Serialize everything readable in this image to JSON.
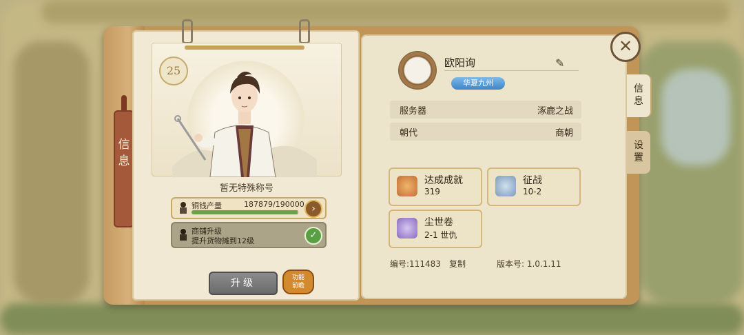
{
  "character": {
    "level": "25",
    "title": "暂无特殊称号",
    "coin_output": {
      "label": "铜钱产量",
      "value": "187879/190000",
      "progress": 0.989
    },
    "shop_upgrade": {
      "label": "商铺升级",
      "desc": "提升货物摊到12级"
    },
    "upgrade_button": "升级",
    "preview_button_line1": "功能",
    "preview_button_line2": "前瞻"
  },
  "spine_label": "信息",
  "player": {
    "name": "欧阳询",
    "server_tag": "华夏九州",
    "info": [
      {
        "key": "服务器",
        "value": "涿鹿之战"
      },
      {
        "key": "朝代",
        "value": "商朝"
      }
    ],
    "achievements": [
      {
        "title": "达成成就",
        "value": "319",
        "icon": "phoenix-emblem-icon"
      },
      {
        "title": "征战",
        "value": "10-2",
        "icon": "crossed-swords-icon"
      },
      {
        "title": "尘世卷",
        "value": "2-1 世仇",
        "icon": "purple-crest-icon"
      }
    ],
    "id_text": "编号:111483",
    "copy_label": "复制",
    "version_text": "版本号: 1.0.1.11"
  },
  "tabs": {
    "info": "信息",
    "settings": "设置"
  },
  "colors": {
    "progress": "#6aa24a",
    "server_tag": "#3e86c8"
  }
}
